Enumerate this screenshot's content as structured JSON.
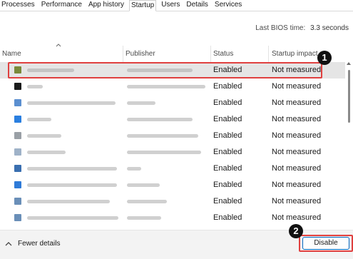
{
  "tabs": [
    {
      "label": "Processes"
    },
    {
      "label": "Performance"
    },
    {
      "label": "App history"
    },
    {
      "label": "Startup"
    },
    {
      "label": "Users"
    },
    {
      "label": "Details"
    },
    {
      "label": "Services"
    }
  ],
  "active_tab": "Startup",
  "bios": {
    "label": "Last BIOS time:",
    "value": "3.3 seconds"
  },
  "columns": {
    "name": "Name",
    "publisher": "Publisher",
    "status": "Status",
    "impact": "Startup impact"
  },
  "rows": [
    {
      "status": "Enabled",
      "impact": "Not measured",
      "icon_color": "#7a8a3a",
      "selected": true
    },
    {
      "status": "Enabled",
      "impact": "Not measured",
      "icon_color": "#1b1b1b"
    },
    {
      "status": "Enabled",
      "impact": "Not measured",
      "icon_color": "#5b8fd0"
    },
    {
      "status": "Enabled",
      "impact": "Not measured",
      "icon_color": "#2a7fe0"
    },
    {
      "status": "Enabled",
      "impact": "Not measured",
      "icon_color": "#9aa0a6"
    },
    {
      "status": "Enabled",
      "impact": "Not measured",
      "icon_color": "#9fb2c8"
    },
    {
      "status": "Enabled",
      "impact": "Not measured",
      "icon_color": "#3a6fb0"
    },
    {
      "status": "Enabled",
      "impact": "Not measured",
      "icon_color": "#2f7bd8"
    },
    {
      "status": "Enabled",
      "impact": "Not measured",
      "icon_color": "#6a8fb8"
    },
    {
      "status": "Enabled",
      "impact": "Not measured",
      "icon_color": "#6a8fb8"
    }
  ],
  "badges": {
    "one": "1",
    "two": "2"
  },
  "footer": {
    "fewer_details": "Fewer details",
    "disable_label": "Disable"
  },
  "colors": {
    "highlight": "#e0403f",
    "accent": "#0067c0",
    "selected_row": "#e5e5e5"
  },
  "icons": {
    "sort": "chevron-up-icon",
    "fewer": "chevron-up-icon"
  }
}
